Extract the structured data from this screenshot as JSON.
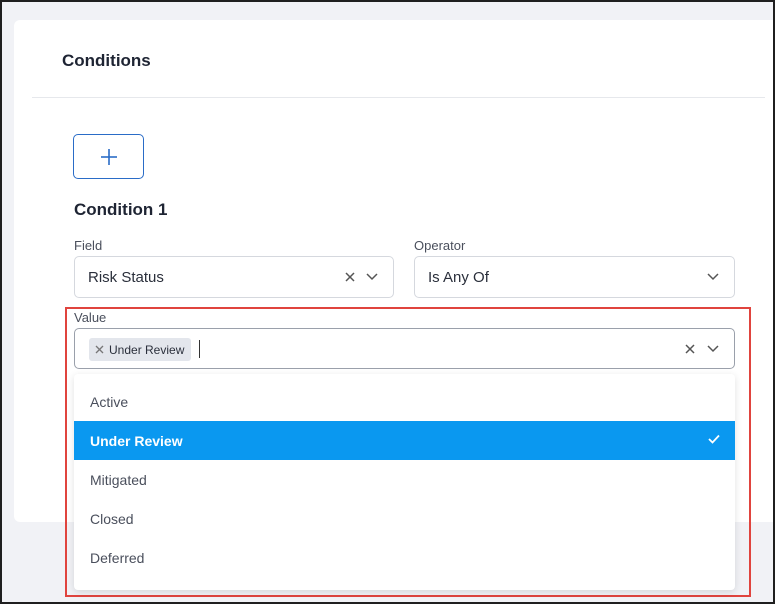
{
  "section": {
    "title": "Conditions",
    "add_button_icon": "plus-icon"
  },
  "condition": {
    "title": "Condition 1",
    "field": {
      "label": "Field",
      "value": "Risk Status"
    },
    "operator": {
      "label": "Operator",
      "value": "Is Any Of"
    },
    "value": {
      "label": "Value",
      "chips": [
        "Under Review"
      ]
    }
  },
  "dropdown": {
    "options": [
      {
        "label": "Active",
        "selected": false
      },
      {
        "label": "Under Review",
        "selected": true
      },
      {
        "label": "Mitigated",
        "selected": false
      },
      {
        "label": "Closed",
        "selected": false
      },
      {
        "label": "Deferred",
        "selected": false
      }
    ]
  },
  "colors": {
    "accent": "#0a98f0",
    "highlight_border": "#e0443e",
    "button_border": "#2a6cc7"
  }
}
